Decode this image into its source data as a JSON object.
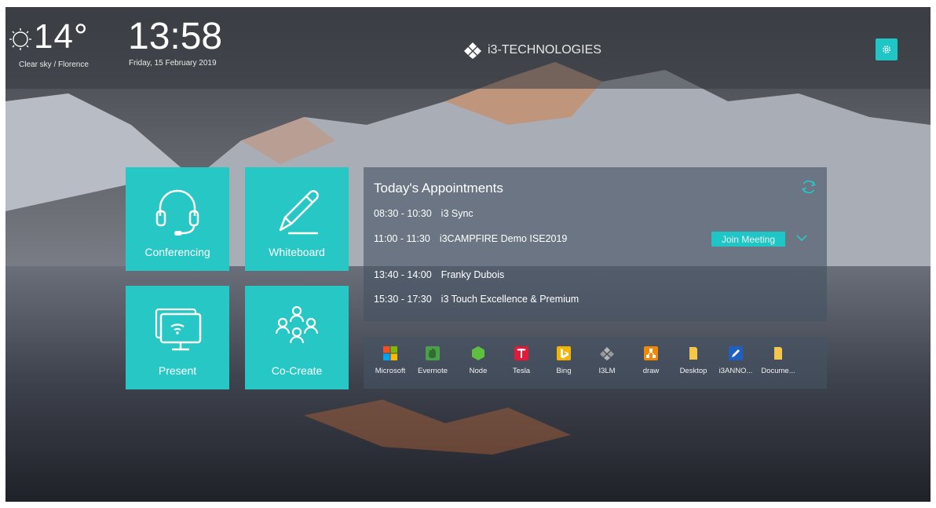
{
  "weather": {
    "temperature": "14°",
    "description": "Clear sky / Florence",
    "icon": "sun-icon"
  },
  "clock": {
    "time": "13:58",
    "date": "Friday, 15 February 2019"
  },
  "brand": {
    "name": "i3-TECHNOLOGIES",
    "icon": "diamond-logo-icon"
  },
  "settings": {
    "icon": "gear-icon"
  },
  "tiles": [
    {
      "label": "Conferencing",
      "icon": "headset-icon"
    },
    {
      "label": "Whiteboard",
      "icon": "pen-icon"
    },
    {
      "label": "Present",
      "icon": "screen-share-icon"
    },
    {
      "label": "Co-Create",
      "icon": "people-group-icon"
    }
  ],
  "appointments": {
    "title": "Today's Appointments",
    "items": [
      {
        "time": "08:30 - 10:30",
        "subject": "i3 Sync"
      },
      {
        "time": "11:00 - 11:30",
        "subject": "i3CAMPFIRE Demo ISE2019"
      },
      {
        "time": "13:40 - 14:00",
        "subject": "Franky Dubois"
      },
      {
        "time": "15:30 - 17:30",
        "subject": "i3 Touch Excellence & Premium"
      }
    ],
    "join_label": "Join Meeting"
  },
  "apps": [
    {
      "label": "Microsoft",
      "icon": "microsoft-icon",
      "color": "#f25022"
    },
    {
      "label": "Evernote",
      "icon": "evernote-icon",
      "color": "#4aa04a"
    },
    {
      "label": "Node",
      "icon": "node-icon",
      "color": "#5fbf3f"
    },
    {
      "label": "Tesla",
      "icon": "tesla-icon",
      "color": "#e31937"
    },
    {
      "label": "Bing",
      "icon": "bing-icon",
      "color": "#f5b400"
    },
    {
      "label": "I3LM",
      "icon": "i3lm-icon",
      "color": "#9a9a9a"
    },
    {
      "label": "draw",
      "icon": "draw-icon",
      "color": "#f08705"
    },
    {
      "label": "Desktop",
      "icon": "folder-icon",
      "color": "#f3c74a"
    },
    {
      "label": "i3ANNO...",
      "icon": "annotate-icon",
      "color": "#1f5fbf"
    },
    {
      "label": "Docume...",
      "icon": "folder-icon",
      "color": "#f3c74a"
    }
  ],
  "colors": {
    "accent": "#27c7c6"
  }
}
